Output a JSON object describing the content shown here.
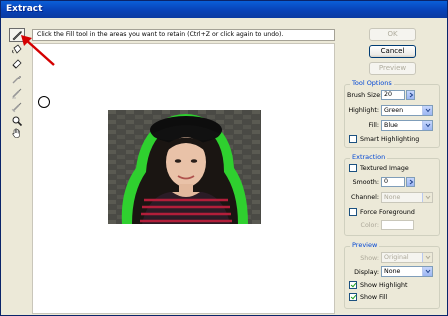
{
  "window": {
    "title": "Extract"
  },
  "hint": "Click the Fill tool in the areas you want to retain (Ctrl+Z or click again to undo).",
  "buttons": {
    "ok": "OK",
    "cancel": "Cancel",
    "preview": "Preview"
  },
  "tool_options": {
    "title": "Tool Options",
    "brush_size_label": "Brush Size:",
    "brush_size_value": "20",
    "highlight_label": "Highlight:",
    "highlight_value": "Green",
    "fill_label": "Fill:",
    "fill_value": "Blue",
    "smart_highlighting": "Smart Highlighting"
  },
  "extraction": {
    "title": "Extraction",
    "textured_image": "Textured Image",
    "smooth_label": "Smooth:",
    "smooth_value": "0",
    "channel_label": "Channel:",
    "channel_value": "None",
    "force_foreground": "Force Foreground",
    "color_label": "Color:"
  },
  "preview": {
    "title": "Preview",
    "show_label": "Show:",
    "show_value": "Original",
    "display_label": "Display:",
    "display_value": "None",
    "show_highlight": "Show Highlight",
    "show_fill": "Show Fill",
    "show_highlight_checked": true,
    "show_fill_checked": true
  },
  "tools": [
    "edge-highlighter-icon",
    "fill-icon",
    "eraser-icon",
    "eyedropper-icon",
    "cleanup-icon",
    "edge-touchup-icon",
    "zoom-icon",
    "hand-icon"
  ],
  "colors": {
    "title_bar": "#0842b8",
    "highlight": "#22cc22",
    "annotation_arrow": "#d40000",
    "group_title": "#0046d5"
  }
}
